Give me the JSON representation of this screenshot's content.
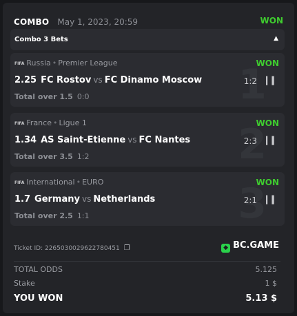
{
  "header": {
    "title": "COMBO",
    "date": "May 1, 2023, 20:59",
    "status": "WON"
  },
  "toggle": {
    "label": "Combo 3 Bets",
    "arrow_icon": "caret-up-icon"
  },
  "bets": [
    {
      "index": "1",
      "country": "Russia",
      "league": "Premier League",
      "status": "WON",
      "odds": "2.25",
      "home": "FC Rostov",
      "vs": "vs",
      "away": "FC Dinamo Moscow",
      "score": "1:2",
      "market": "Total over 1.5",
      "result": "0:0"
    },
    {
      "index": "2",
      "country": "France",
      "league": "Ligue 1",
      "status": "WON",
      "odds": "1.34",
      "home": "AS Saint-Etienne",
      "vs": "vs",
      "away": "FC Nantes",
      "score": "2:3",
      "market": "Total over 3.5",
      "result": "1:2"
    },
    {
      "index": "3",
      "country": "International",
      "league": "EURO",
      "status": "WON",
      "odds": "1.7",
      "home": "Germany",
      "vs": "vs",
      "away": "Netherlands",
      "score": "2:1",
      "market": "Total over 2.5",
      "result": "1:1"
    }
  ],
  "fifa_label": "FIFA",
  "ticket": {
    "label": "Ticket ID: 2265030029622780451"
  },
  "brand": {
    "name": "BC.GAME",
    "color": "#2ad14b"
  },
  "summary": {
    "total_odds_label": "TOTAL ODDS",
    "total_odds": "5.125",
    "stake_label": "Stake",
    "stake": "1 $",
    "won_label": "YOU WON",
    "won": "5.13 $"
  },
  "colors": {
    "won": "#3fcc2f",
    "background": "#17181b",
    "card": "#232428",
    "panel": "#2b2c31"
  }
}
